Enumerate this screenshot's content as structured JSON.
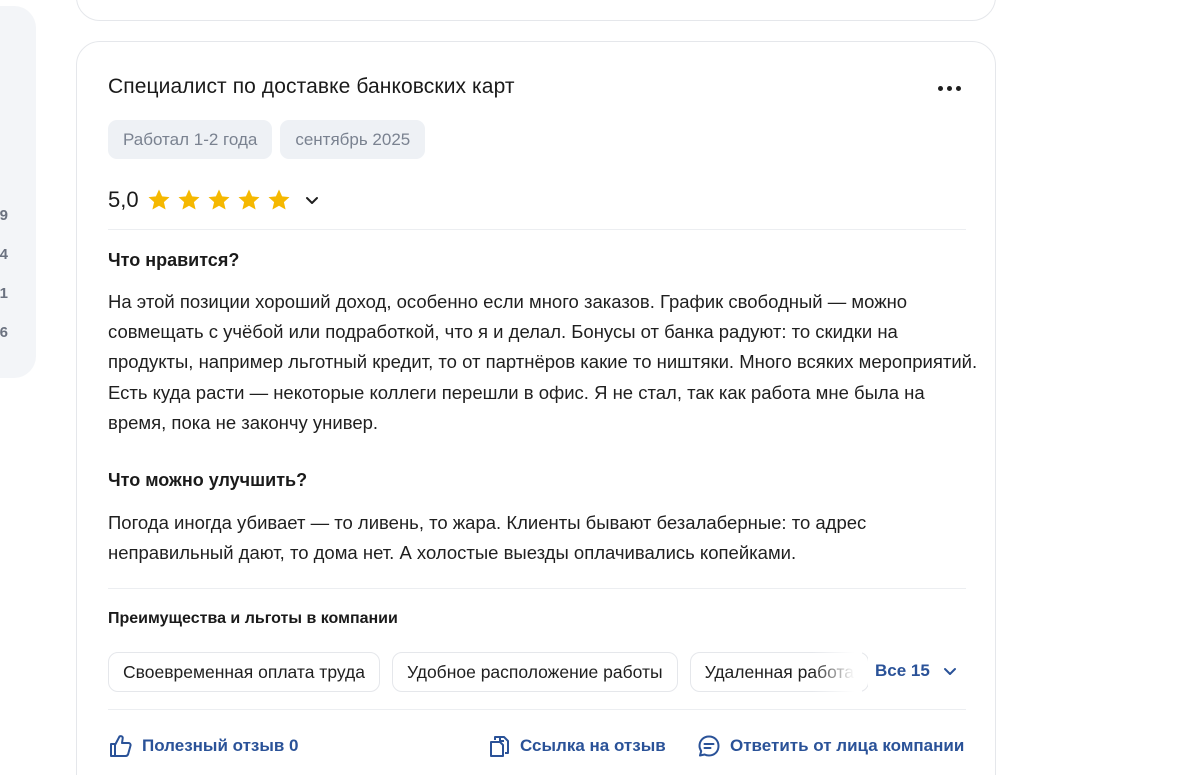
{
  "sidebar": {
    "numbers": [
      "9",
      "4",
      "1",
      "6"
    ]
  },
  "review": {
    "title": "Специалист по доставке банковских карт",
    "tags": [
      "Работал 1-2 года",
      "сентябрь 2025"
    ],
    "rating": "5,0",
    "stars": 5,
    "likes_heading": "Что нравится?",
    "likes_text": "На этой позиции хороший доход, особенно если много заказов. График свободный — можно совмещать с учёбой или подработкой, что я и делал. Бонусы от банка радуют: то скидки на продукты, например льготный кредит, то от партнёров какие то ништяки. Много всяких мероприятий. Есть куда расти — некоторые коллеги перешли в офис. Я не стал, так как работа мне была на время, пока не закончу универ.",
    "improve_heading": "Что можно улучшить?",
    "improve_text": "Погода иногда убивает — то ливень, то жара. Клиенты бывают безалаберные: то адрес неправильный дают, то дома нет. А холостые выезды оплачивались копейками.",
    "benefits_heading": "Преимущества и льготы в компании",
    "benefits": [
      "Своевременная оплата труда",
      "Удобное расположение работы",
      "Удаленная работа"
    ],
    "benefits_all": "Все 15",
    "actions": {
      "helpful": "Полезный отзыв 0",
      "link": "Ссылка на отзыв",
      "reply": "Ответить от лица компании"
    }
  },
  "colors": {
    "star": "#f5b800",
    "link": "#2a5298",
    "chip_bg": "#eef1f5"
  }
}
